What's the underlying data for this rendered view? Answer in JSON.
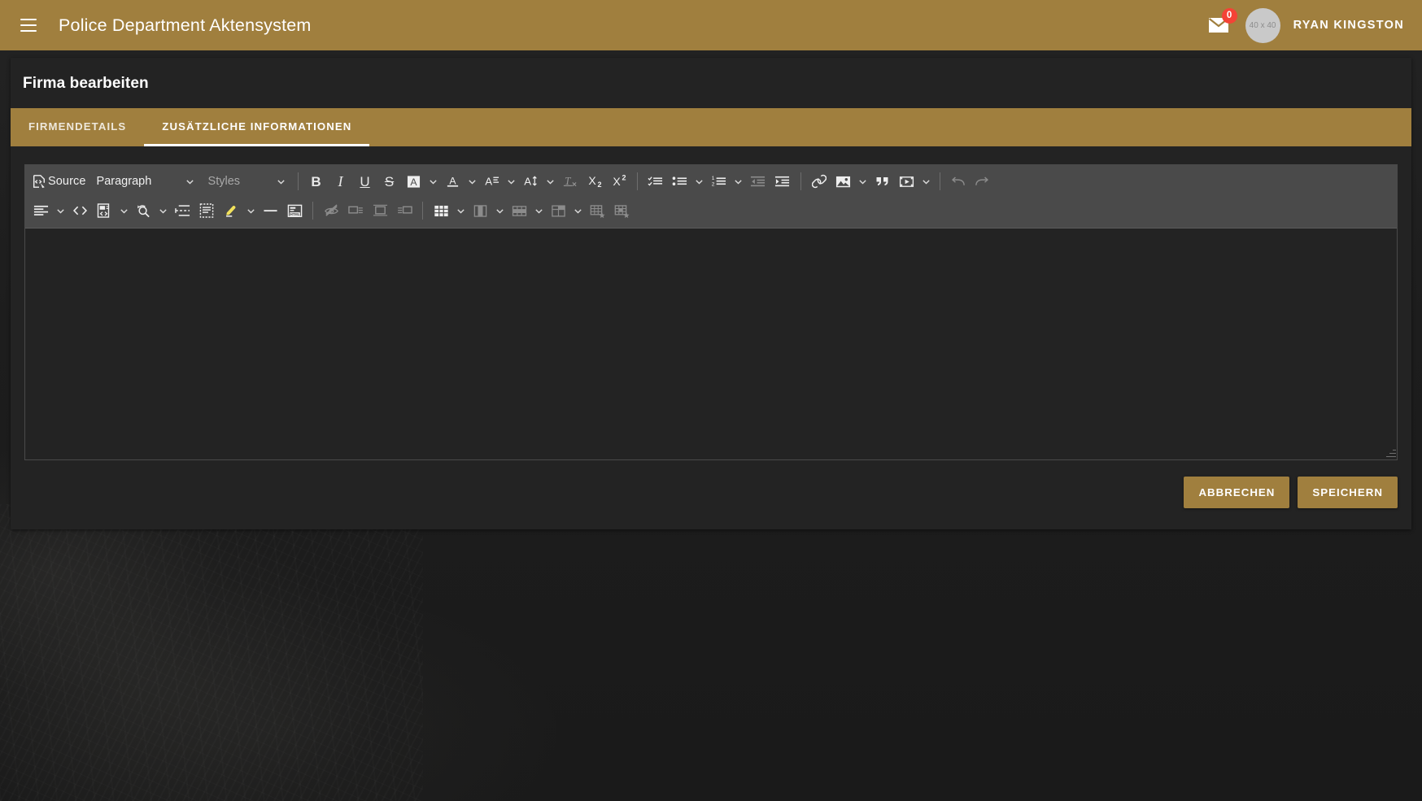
{
  "appbar": {
    "menu_icon": "hamburger-menu-icon",
    "title": "Police Department Aktensystem",
    "mail_icon": "envelope-icon",
    "mail_badge": "0",
    "avatar_label": "40 x 40",
    "username": "RYAN KINGSTON",
    "background_color": "#a07f3e"
  },
  "card": {
    "title": "Firma bearbeiten",
    "tabs": [
      {
        "label": "FIRMENDETAILS",
        "active": false
      },
      {
        "label": "ZUSÄTZLICHE INFORMATIONEN",
        "active": true
      }
    ]
  },
  "editor": {
    "source_label": "Source",
    "paragraph_dropdown": "Paragraph",
    "styles_dropdown": "Styles",
    "content": "",
    "toolbar_row1": [
      {
        "name": "source-button",
        "label": "Source"
      },
      {
        "name": "paragraph-format-dropdown",
        "label": "Paragraph"
      },
      {
        "name": "styles-dropdown",
        "label": "Styles"
      },
      {
        "name": "bold-button",
        "label": "B"
      },
      {
        "name": "italic-button",
        "label": "I"
      },
      {
        "name": "underline-button",
        "label": "U"
      },
      {
        "name": "strikethrough-button",
        "label": "S"
      },
      {
        "name": "font-background-color-button",
        "label": "A"
      },
      {
        "name": "font-color-button",
        "label": "A"
      },
      {
        "name": "font-family-button",
        "label": "A"
      },
      {
        "name": "font-size-button",
        "label": "A"
      },
      {
        "name": "remove-format-button",
        "label": "Tx"
      },
      {
        "name": "subscript-button",
        "label": "X2"
      },
      {
        "name": "superscript-button",
        "label": "X2"
      },
      {
        "name": "todo-list-button",
        "label": "Todo list"
      },
      {
        "name": "bulleted-list-button",
        "label": "Bulleted list"
      },
      {
        "name": "numbered-list-button",
        "label": "Numbered list"
      },
      {
        "name": "decrease-indent-button",
        "label": "Decrease indent"
      },
      {
        "name": "increase-indent-button",
        "label": "Increase indent"
      },
      {
        "name": "link-button",
        "label": "Link"
      },
      {
        "name": "insert-image-button",
        "label": "Insert image"
      },
      {
        "name": "block-quote-button",
        "label": "Block quote"
      },
      {
        "name": "insert-media-button",
        "label": "Insert media"
      },
      {
        "name": "undo-button",
        "label": "Undo"
      },
      {
        "name": "redo-button",
        "label": "Redo"
      }
    ],
    "toolbar_row2": [
      {
        "name": "text-alignment-button",
        "label": "Text alignment"
      },
      {
        "name": "code-block-button",
        "label": "Code block"
      },
      {
        "name": "insert-template-button",
        "label": "Insert template"
      },
      {
        "name": "find-and-replace-button",
        "label": "Find and replace"
      },
      {
        "name": "page-break-button",
        "label": "Page break"
      },
      {
        "name": "special-characters-button",
        "label": "Special characters"
      },
      {
        "name": "highlight-button",
        "label": "Highlight"
      },
      {
        "name": "horizontal-line-button",
        "label": "Horizontal line"
      },
      {
        "name": "html-embed-button",
        "label": "HTML embed"
      },
      {
        "name": "show-blocks-button",
        "label": "Show blocks"
      },
      {
        "name": "image-align-left-button",
        "label": "Align left"
      },
      {
        "name": "image-align-center-button",
        "label": "Align center"
      },
      {
        "name": "image-align-right-button",
        "label": "Align right"
      },
      {
        "name": "insert-table-button",
        "label": "Insert table"
      },
      {
        "name": "table-column-button",
        "label": "Column"
      },
      {
        "name": "table-row-button",
        "label": "Row"
      },
      {
        "name": "merge-cells-button",
        "label": "Merge cells"
      },
      {
        "name": "table-properties-button",
        "label": "Table properties"
      },
      {
        "name": "table-cell-properties-button",
        "label": "Cell properties"
      }
    ]
  },
  "actions": {
    "cancel_label": "ABBRECHEN",
    "save_label": "SPEICHERN"
  },
  "theme": {
    "accent": "#a07f3e",
    "surface": "#232323",
    "toolbar": "#4a4a4a",
    "badge": "#f44336"
  }
}
